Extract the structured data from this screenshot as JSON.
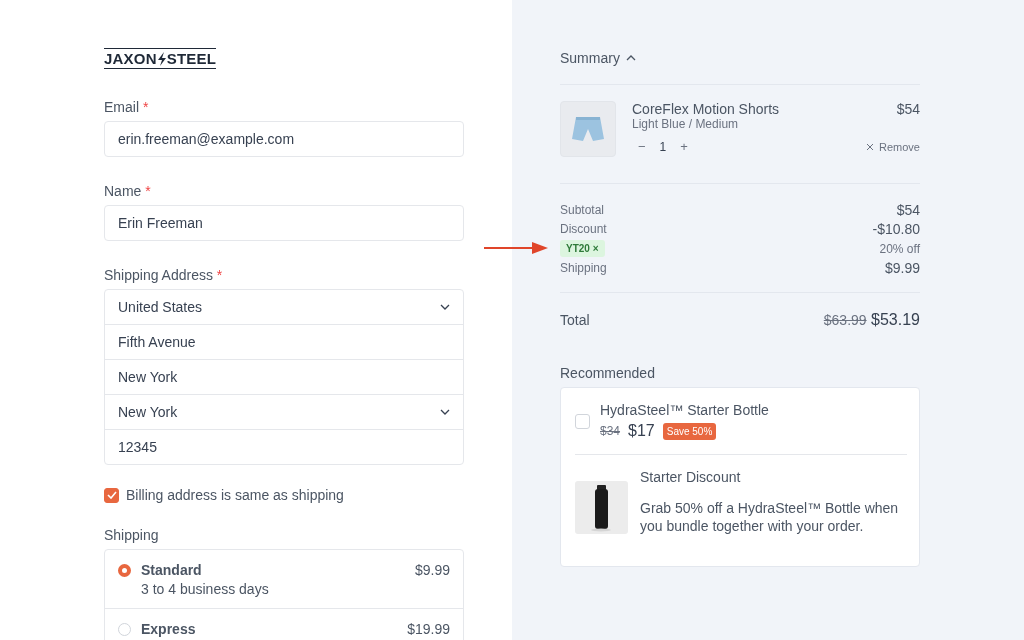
{
  "logo": {
    "left": "JAXON",
    "right": "STEEL"
  },
  "fields": [
    {
      "label": "Email",
      "required": "*",
      "value": "erin.freeman@example.com"
    },
    {
      "label": "Name",
      "required": "*",
      "value": "Erin Freeman"
    }
  ],
  "address": {
    "label": "Shipping Address",
    "required": "*",
    "rows": [
      {
        "kind": "select",
        "value": "United States"
      },
      {
        "kind": "text",
        "value": "Fifth Avenue"
      },
      {
        "kind": "text",
        "value": "New York"
      },
      {
        "kind": "select",
        "value": "New York"
      },
      {
        "kind": "text",
        "value": "12345"
      }
    ]
  },
  "billing_same": {
    "label": "Billing address is same as shipping",
    "checked": true
  },
  "shipping": {
    "label": "Shipping",
    "options": [
      {
        "name": "Standard",
        "detail": "3 to 4 business days",
        "price": "$9.99",
        "selected": true
      },
      {
        "name": "Express",
        "price": "$19.99",
        "selected": false
      }
    ]
  },
  "summary": {
    "title": "Summary",
    "expanded": true,
    "item": {
      "name": "CoreFlex Motion Shorts",
      "variant": "Light Blue / Medium",
      "price": "$54",
      "minus": "−",
      "quantity": "1",
      "plus": "+",
      "remove": "Remove"
    },
    "subtotal": {
      "label": "Subtotal",
      "value": "$54"
    },
    "discount": {
      "label": "Discount",
      "code": "YT20",
      "code_remove": "×",
      "value": "-$10.80",
      "note": "20% off"
    },
    "shipping": {
      "label": "Shipping",
      "value": "$9.99"
    },
    "total": {
      "label": "Total",
      "old": "$63.99",
      "value": "$53.19"
    }
  },
  "recommended": {
    "title": "Recommended",
    "name": "HydraSteel™ Starter Bottle",
    "checked": false,
    "old_price": "$34",
    "price": "$17",
    "badge": "Save 50%",
    "offer_title": "Starter Discount",
    "offer_text": "Grab 50% off a HydraSteel™ Bottle when you bundle together with your order."
  }
}
